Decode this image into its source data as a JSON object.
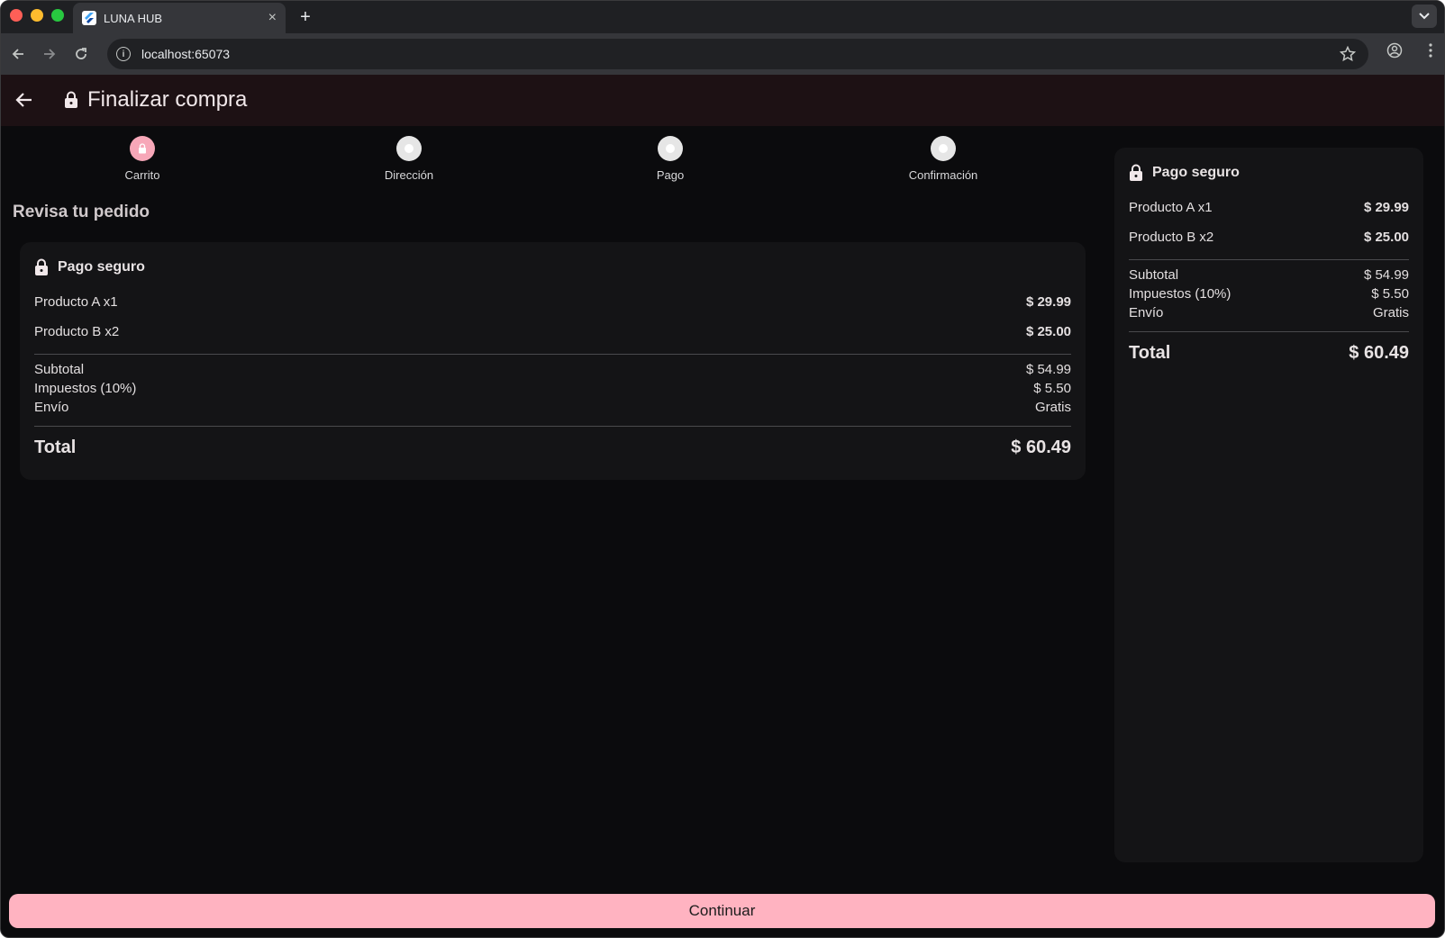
{
  "browser": {
    "tab_title": "LUNA HUB",
    "tab_close": "×",
    "new_tab": "+",
    "url": "localhost:65073",
    "info_glyph": "i"
  },
  "appbar": {
    "title": "Finalizar compra"
  },
  "steps": [
    {
      "label": "Carrito",
      "active": true
    },
    {
      "label": "Dirección",
      "active": false
    },
    {
      "label": "Pago",
      "active": false
    },
    {
      "label": "Confirmación",
      "active": false
    }
  ],
  "review": {
    "title": "Revisa tu pedido"
  },
  "summary": {
    "secure_label": "Pago seguro",
    "items": [
      {
        "name": "Producto A x1",
        "price": "$ 29.99"
      },
      {
        "name": "Producto B x2",
        "price": "$ 25.00"
      }
    ],
    "subtotal_label": "Subtotal",
    "subtotal_value": "$ 54.99",
    "tax_label": "Impuestos (10%)",
    "tax_value": "$ 5.50",
    "shipping_label": "Envío",
    "shipping_value": "Gratis",
    "total_label": "Total",
    "total_value": "$ 60.49"
  },
  "actions": {
    "continue_label": "Continuar"
  },
  "colors": {
    "accent": "#ffb3c1",
    "step_active": "#f7a7b8",
    "appbar": "#1d1114",
    "background": "#0b0b0d",
    "card": "#141416"
  }
}
